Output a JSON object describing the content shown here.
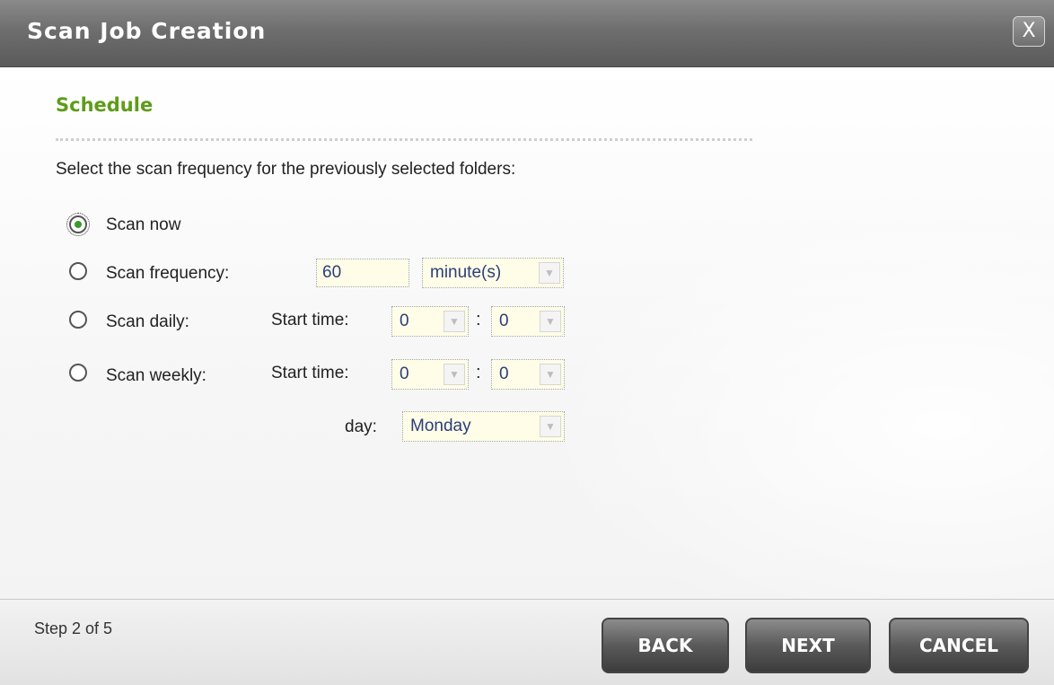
{
  "window": {
    "title": "Scan Job Creation",
    "close_label": "X"
  },
  "section": {
    "title": "Schedule",
    "instruction": "Select the scan frequency for the previously selected folders:"
  },
  "options": {
    "scan_now": {
      "label": "Scan now",
      "selected": true
    },
    "scan_frequency": {
      "label": "Scan frequency:",
      "value": "60",
      "unit": "minute(s)",
      "selected": false
    },
    "scan_daily": {
      "label": "Scan daily:",
      "start_label": "Start time:",
      "hour": "0",
      "separator": ":",
      "minute": "0",
      "selected": false
    },
    "scan_weekly": {
      "label": "Scan weekly:",
      "start_label": "Start time:",
      "hour": "0",
      "separator": ":",
      "minute": "0",
      "day_label": "day:",
      "day": "Monday",
      "selected": false
    }
  },
  "footer": {
    "step": "Step 2 of 5",
    "back_label": "BACK",
    "next_label": "NEXT",
    "cancel_label": "CANCEL"
  },
  "colors": {
    "section_title": "#5e9c1a",
    "title_bar": "#6e6e6e",
    "field_text": "#2a3f7a"
  }
}
